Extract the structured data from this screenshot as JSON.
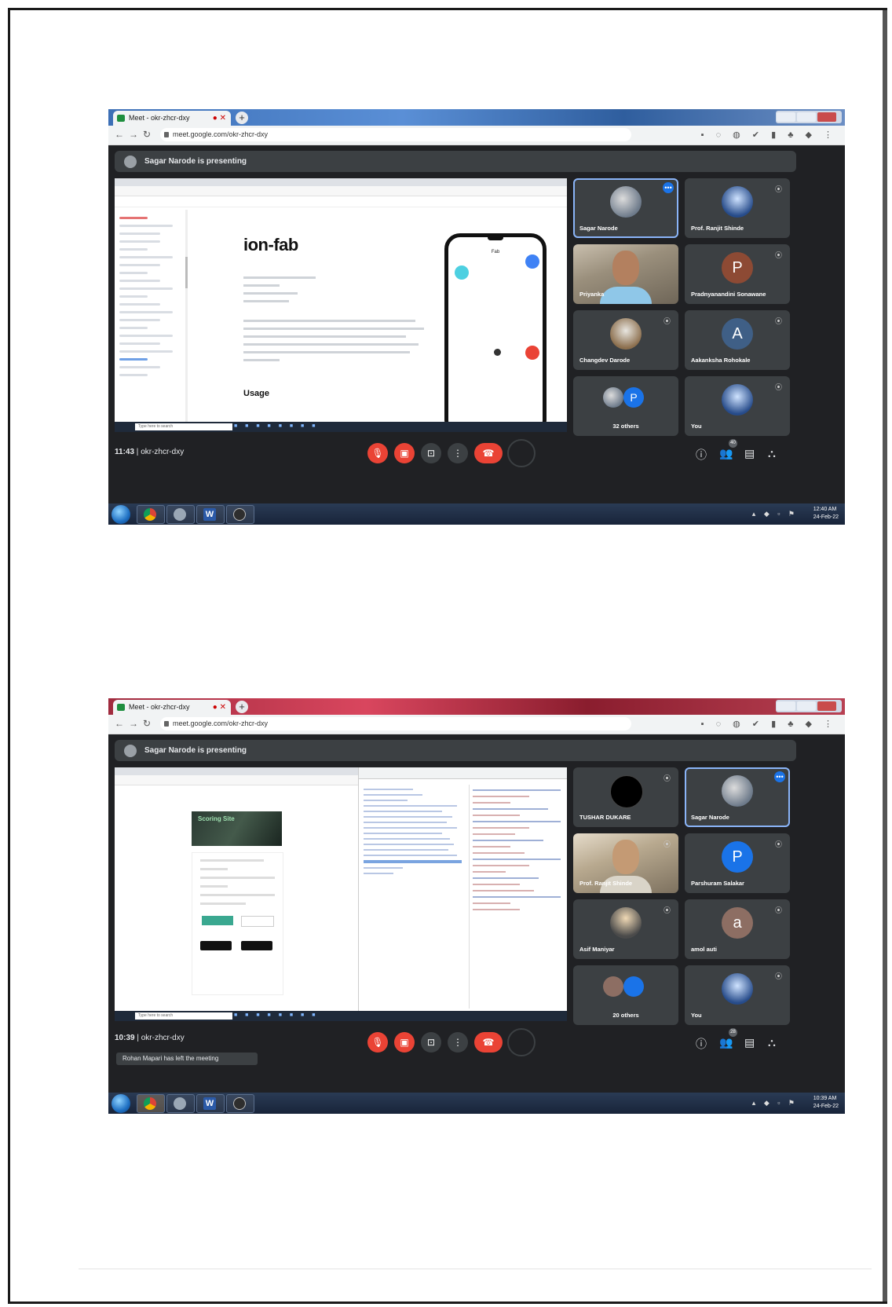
{
  "shots": [
    {
      "browser": {
        "tab_title": "Meet - okr-zhcr-dxy",
        "url": "meet.google.com/okr-zhcr-dxy"
      },
      "presenting_text": "Sagar Narode is presenting",
      "presented": {
        "page_title": "ion-fab",
        "section_heading": "Usage",
        "phone_title": "Fab",
        "search_placeholder": "Type here to search"
      },
      "tiles": [
        {
          "name": "Sagar Narode",
          "type": "photo"
        },
        {
          "name": "Prof. Ranjit Shinde",
          "type": "photo"
        },
        {
          "name": "Priyanka",
          "type": "video"
        },
        {
          "name": "Pradnyanandini Sonawane",
          "type": "letter",
          "letter": "P",
          "color": "#8d4a34"
        },
        {
          "name": "Changdev Darode",
          "type": "photo"
        },
        {
          "name": "Aakanksha Rohokale",
          "type": "letter",
          "letter": "A",
          "color": "#3f5f86"
        },
        {
          "name": "32 others",
          "type": "others",
          "letter": "P"
        },
        {
          "name": "You",
          "type": "photo"
        }
      ],
      "meeting_time": "11:43",
      "meeting_code": "okr-zhcr-dxy",
      "participant_count": "40",
      "clock_time": "12:40 AM",
      "clock_date": "24-Feb-22"
    },
    {
      "browser": {
        "tab_title": "Meet - okr-zhcr-dxy",
        "url": "meet.google.com/okr-zhcr-dxy"
      },
      "presenting_text": "Sagar Narode is presenting",
      "presented": {
        "hero_text": "Scoring Site",
        "search_placeholder": "Type here to search"
      },
      "tiles": [
        {
          "name": "TUSHAR DUKARE",
          "type": "dark"
        },
        {
          "name": "Sagar Narode",
          "type": "photo"
        },
        {
          "name": "Prof. Ranjit Shinde",
          "type": "video"
        },
        {
          "name": "Parshuram Salakar",
          "type": "letter",
          "letter": "P",
          "color": "#1a73e8"
        },
        {
          "name": "Asif Maniyar",
          "type": "photo"
        },
        {
          "name": "amol auti",
          "type": "letter",
          "letter": "a",
          "color": "#8d6e63"
        },
        {
          "name": "20 others",
          "type": "others",
          "letter": "P"
        },
        {
          "name": "You",
          "type": "photo"
        }
      ],
      "meeting_time": "10:39",
      "meeting_code": "okr-zhcr-dxy",
      "toast": "Rohan Mapari has left the meeting",
      "participant_count": "28",
      "clock_time": "10:39 AM",
      "clock_date": "24-Feb-22"
    }
  ]
}
